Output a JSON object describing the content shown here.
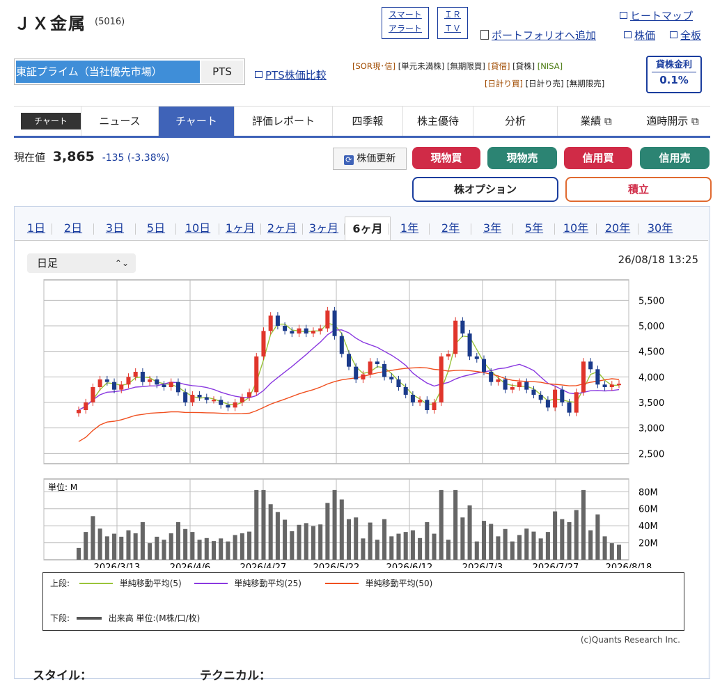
{
  "company": {
    "name": "ＪＸ金属",
    "code": "(5016)"
  },
  "top_boxes": {
    "smart_1": "スマート",
    "smart_2": "アラート",
    "ir_1": "ＩＲ",
    "ir_2": "ＴＶ"
  },
  "top_links": {
    "heatmap": "ヒートマップ",
    "portfolio": "ポートフォリオへ追加",
    "kabuka": "株価",
    "zenban": "全板"
  },
  "market": {
    "selected": "東証プライム（当社優先市場）",
    "pts": "PTS",
    "compare": "PTS株価比較"
  },
  "tags": {
    "sor": "[SOR現･信]",
    "tangen": "[単元未満株]",
    "mukigen": "[無期限買]",
    "kashi": "[貸借]",
    "kashikabu": "[貸株]",
    "nisa": "[NISA]",
    "hibuy": "[日計り買]",
    "hisell": "[日計り売]",
    "mukigensell": "[無期限売]"
  },
  "lending": {
    "label": "貸株金利",
    "value": "0.1%"
  },
  "tabs": {
    "chip": "チャート",
    "news": "ニュース",
    "chart": "チャート",
    "report": "評価レポート",
    "shikiho": "四季報",
    "yutai": "株主優待",
    "analysis": "分析",
    "gyoseki": "業績 ⧉",
    "kaiji": "適時開示 ⧉"
  },
  "price": {
    "label": "現在値",
    "value": "3,865",
    "change": "-135 (-3.38%)"
  },
  "buttons": {
    "update": "株価更新",
    "genbuy": "現物買",
    "gensell": "現物売",
    "shinbuy": "信用買",
    "shinsell": "信用売",
    "option": "株オプション",
    "tsumitate": "積立"
  },
  "periods": [
    "1日",
    "2日",
    "3日",
    "5日",
    "10日",
    "1ヶ月",
    "2ヶ月",
    "3ヶ月",
    "6ヶ月",
    "1年",
    "2年",
    "3年",
    "5年",
    "10年",
    "20年",
    "30年"
  ],
  "selected_period": "6ヶ月",
  "chart_type_select": "日足",
  "timestamp": "26/08/18 13:25",
  "chart_data": {
    "type": "candlestick",
    "y_ticks": [
      "5,500",
      "5,000",
      "4,500",
      "4,000",
      "3,500",
      "3,000",
      "2,500"
    ],
    "ylim": [
      2300,
      5900
    ],
    "x_ticks": [
      "2026/3/13",
      "2026/4/6",
      "2026/4/27",
      "2026/5/22",
      "2026/6/12",
      "2026/7/3",
      "2026/7/27",
      "2026/8/18"
    ],
    "close": [
      3350,
      3500,
      3800,
      3950,
      3900,
      3750,
      3850,
      4000,
      4100,
      3900,
      3950,
      3850,
      3800,
      3900,
      3700,
      3500,
      3650,
      3600,
      3550,
      3550,
      3450,
      3400,
      3500,
      3600,
      3700,
      4400,
      4900,
      5200,
      5000,
      4900,
      4850,
      4950,
      4850,
      4900,
      4950,
      5300,
      4800,
      4450,
      4200,
      3950,
      4050,
      4300,
      4250,
      4000,
      3950,
      3800,
      3650,
      3500,
      3550,
      3350,
      3500,
      4400,
      4450,
      5100,
      4850,
      4400,
      4350,
      4100,
      3900,
      3950,
      3750,
      3800,
      3900,
      3750,
      3650,
      3550,
      3400,
      3750,
      3500,
      3300,
      3700,
      4300,
      4150,
      3850,
      3800,
      3850,
      3865
    ],
    "volume_ticks": [
      "80M",
      "60M",
      "40M",
      "20M"
    ],
    "volume_unit": "単位: M"
  },
  "legend": {
    "upper": "上段:",
    "ma5": "単純移動平均(5)",
    "ma25": "単純移動平均(25)",
    "ma50": "単純移動平均(50)",
    "lower": "下段:",
    "volume": "出来高 単位:(M株/口/枚)"
  },
  "colors": {
    "ma5": "#9ac43a",
    "ma25": "#8a39e0",
    "ma50": "#f05020",
    "up": "#e0352b",
    "down": "#1a3a8a"
  },
  "copyright": "(c)Quants Research Inc.",
  "bottom": {
    "style": "スタイル：",
    "technical": "テクニカル："
  }
}
